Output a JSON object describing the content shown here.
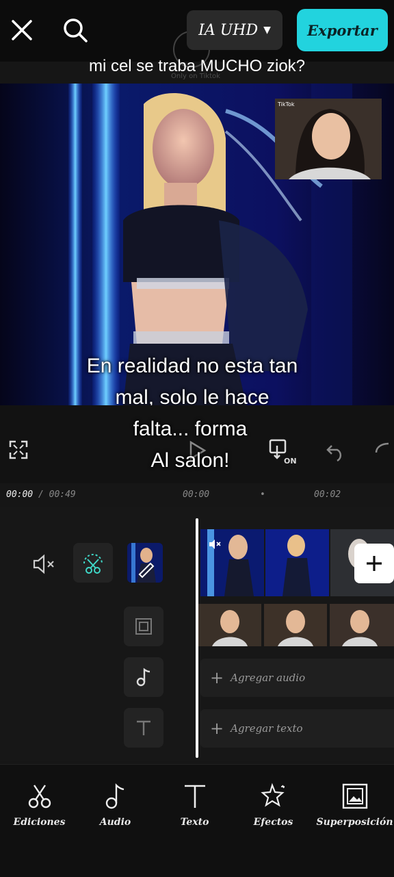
{
  "header": {
    "resolution_label": "IA UHD",
    "export_label": "Exportar",
    "top_caption": "mi cel se traba MUCHO ziok?",
    "watermark": "Only on Tiktok"
  },
  "preview": {
    "overlay_lines": [
      "En realidad no esta tan",
      "mal, solo le hace",
      "falta... forma",
      "Al salon!"
    ],
    "pip_badge": "TikTok"
  },
  "playback": {
    "current_time": "00:00",
    "separator": "/",
    "total_time": "00:49",
    "ruler_marks": [
      "00:00",
      "•",
      "00:02"
    ]
  },
  "timeline": {
    "add_audio_label": "Agregar audio",
    "add_text_label": "Agregar texto"
  },
  "bottom_nav": [
    {
      "label": "Ediciones",
      "icon": "scissors-icon"
    },
    {
      "label": "Audio",
      "icon": "music-note-icon"
    },
    {
      "label": "Texto",
      "icon": "text-icon"
    },
    {
      "label": "Efectos",
      "icon": "effects-star-icon"
    },
    {
      "label": "Superposición",
      "icon": "overlay-image-icon"
    }
  ],
  "colors": {
    "accent": "#22d3de",
    "background": "#161616"
  }
}
